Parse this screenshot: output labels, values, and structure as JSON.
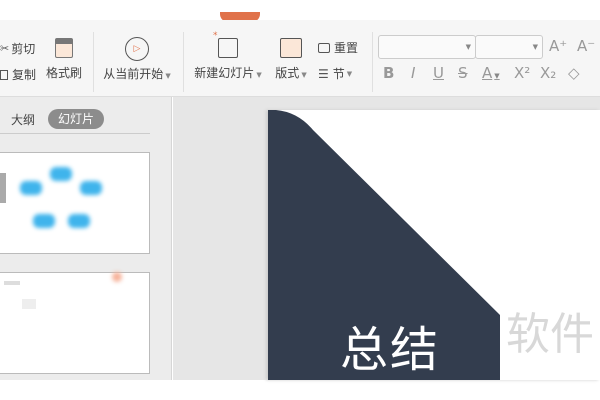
{
  "ribbon": {
    "cut": "剪切",
    "copy": "复制",
    "format_painter": "格式刷",
    "from_current": "从当前开始",
    "new_slide": "新建幻灯片",
    "layout": "版式",
    "reset": "重置",
    "section": "节",
    "font_name": "",
    "font_size": "",
    "bold": "B",
    "italic": "I",
    "underline": "U",
    "strike": "S",
    "font_color": "A",
    "superscript": "X²",
    "subscript": "X₂",
    "grow": "A⁺",
    "shrink": "A⁻"
  },
  "panel": {
    "tabs": [
      {
        "label": "大纲",
        "active": false
      },
      {
        "label": "幻灯片",
        "active": true
      }
    ]
  },
  "slide": {
    "title": "总结",
    "watermark": "软件",
    "dark_color": "#333d4e"
  }
}
